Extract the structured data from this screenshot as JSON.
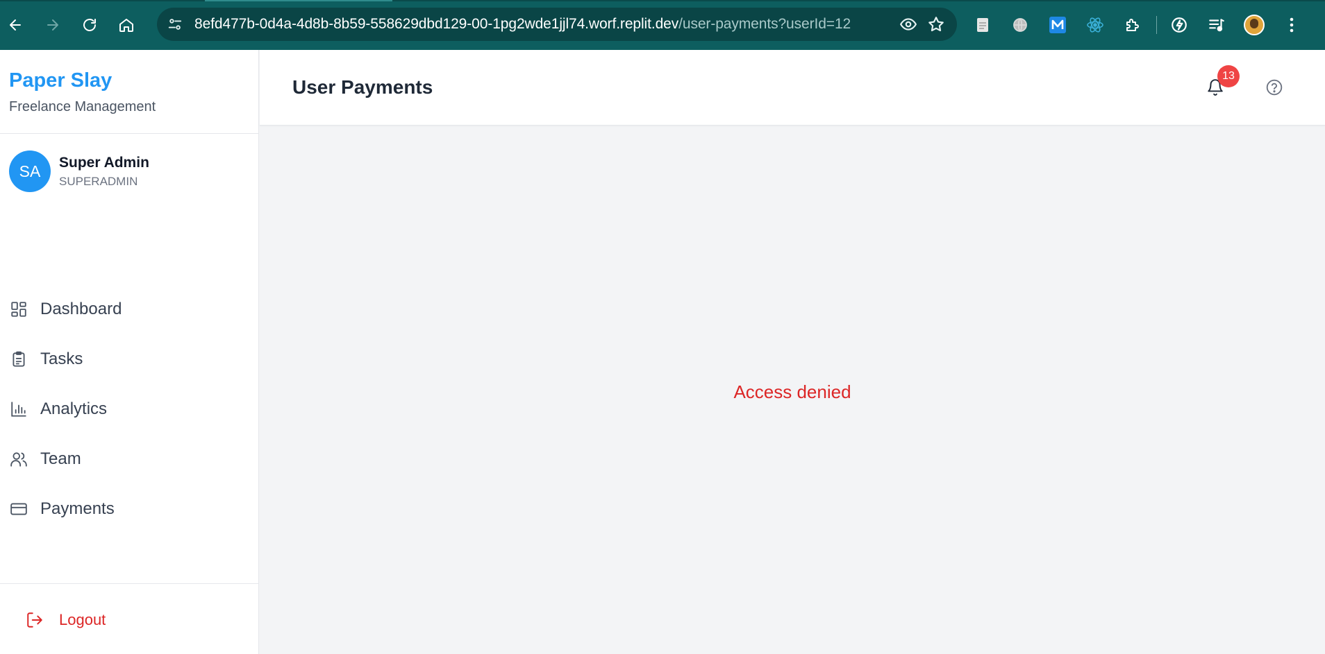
{
  "browser": {
    "url_host": "8efd477b-0d4a-4d8b-8b59-558629dbd129-00-1pg2wde1jjl74.worf.replit.dev",
    "url_path": "/user-payments?userId=12",
    "theme_color": "#0d5e5f"
  },
  "sidebar": {
    "brand_title": "Paper Slay",
    "brand_subtitle": "Freelance Management",
    "user": {
      "initials": "SA",
      "name": "Super Admin",
      "role": "SUPERADMIN"
    },
    "items": [
      {
        "label": "Dashboard",
        "icon": "dashboard-icon"
      },
      {
        "label": "Tasks",
        "icon": "clipboard-icon"
      },
      {
        "label": "Analytics",
        "icon": "bar-chart-icon"
      },
      {
        "label": "Team",
        "icon": "users-icon"
      },
      {
        "label": "Payments",
        "icon": "credit-card-icon"
      }
    ],
    "logout_label": "Logout"
  },
  "header": {
    "title": "User Payments",
    "notification_count": "13"
  },
  "main": {
    "message": "Access denied"
  },
  "colors": {
    "brand": "#2196f3",
    "danger": "#dc2626",
    "badge": "#ef4444"
  }
}
